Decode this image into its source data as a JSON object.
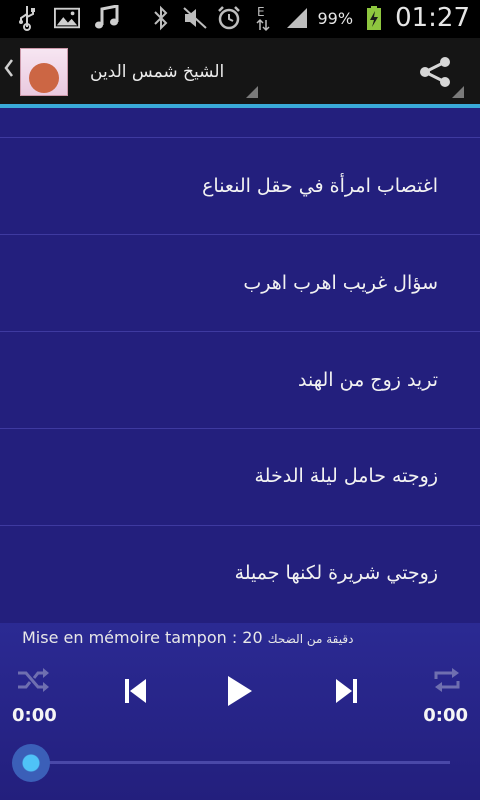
{
  "statusbar": {
    "battery_percent": "99%",
    "clock": "01:27",
    "icons": [
      "usb-icon",
      "image-icon",
      "music-icon",
      "bluetooth-icon",
      "mute-icon",
      "alarm-icon",
      "edge-data-icon",
      "signal-icon",
      "battery-charging-icon"
    ]
  },
  "actionbar": {
    "title": "الشيخ شمس الدين",
    "back_icon": "chevron-left-icon",
    "share_icon": "share-icon"
  },
  "list": {
    "items": [
      {
        "label": "اغتصاب امرأة في حقل النعناع"
      },
      {
        "label": "سؤال غريب اهرب اهرب"
      },
      {
        "label": "تريد زوج من الهند"
      },
      {
        "label": "زوجته حامل ليلة الدخلة"
      },
      {
        "label": "زوجتي شريرة  لكنها جميلة"
      }
    ]
  },
  "player": {
    "buffer_label": "Mise en mémoire tampon : 20",
    "buffer_track": "دقيقة من الضحك",
    "elapsed": "0:00",
    "duration": "0:00",
    "progress_fraction": 0,
    "controls": [
      "shuffle-icon",
      "previous-icon",
      "play-icon",
      "next-icon",
      "repeat-icon"
    ]
  },
  "colors": {
    "list_bg": "#231f7d",
    "accent": "#39a9d9",
    "divider": "#3e3aa0"
  }
}
